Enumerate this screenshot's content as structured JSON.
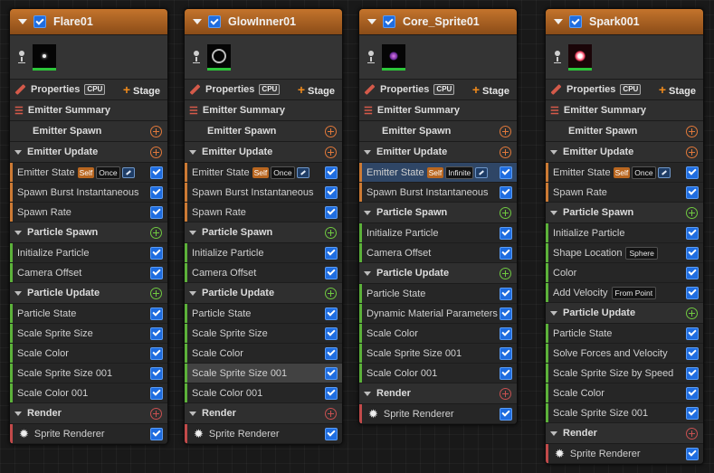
{
  "emitters": [
    {
      "name": "Flare01",
      "thumb": "flare",
      "properties": "Properties",
      "cpu": "CPU",
      "stage": "Stage",
      "sections": [
        {
          "title": "Emitter Summary",
          "icon": "list",
          "chevron": false,
          "add": null,
          "modules": []
        },
        {
          "title": "Emitter Spawn",
          "icon": null,
          "chevron": false,
          "add": "orange",
          "modules": []
        },
        {
          "title": "Emitter Update",
          "icon": null,
          "chevron": true,
          "add": "orange",
          "stripe": "orange",
          "modules": [
            {
              "label": "Emitter State",
              "chips": [
                "Self",
                "Once"
              ],
              "icon": true
            },
            {
              "label": "Spawn Burst Instantaneous"
            },
            {
              "label": "Spawn Rate"
            }
          ]
        },
        {
          "title": "Particle Spawn",
          "icon": null,
          "chevron": true,
          "add": "green",
          "stripe": "green",
          "modules": [
            {
              "label": "Initialize Particle"
            },
            {
              "label": "Camera Offset"
            }
          ]
        },
        {
          "title": "Particle Update",
          "icon": null,
          "chevron": true,
          "add": "green",
          "stripe": "green",
          "modules": [
            {
              "label": "Particle State"
            },
            {
              "label": "Scale Sprite Size"
            },
            {
              "label": "Scale Color"
            },
            {
              "label": "Scale Sprite Size 001"
            },
            {
              "label": "Scale Color 001"
            }
          ]
        },
        {
          "title": "Render",
          "icon": null,
          "chevron": true,
          "add": "red",
          "stripe": "red",
          "modules": [
            {
              "label": "Sprite Renderer",
              "star": true
            }
          ]
        }
      ]
    },
    {
      "name": "GlowInner01",
      "thumb": "glow",
      "properties": "Properties",
      "cpu": "CPU",
      "stage": "Stage",
      "sections": [
        {
          "title": "Emitter Summary",
          "icon": "list",
          "chevron": false,
          "add": null,
          "modules": []
        },
        {
          "title": "Emitter Spawn",
          "icon": null,
          "chevron": false,
          "add": "orange",
          "modules": []
        },
        {
          "title": "Emitter Update",
          "icon": null,
          "chevron": true,
          "add": "orange",
          "stripe": "orange",
          "modules": [
            {
              "label": "Emitter State",
              "chips": [
                "Self",
                "Once"
              ],
              "icon": true
            },
            {
              "label": "Spawn Burst Instantaneous"
            },
            {
              "label": "Spawn Rate"
            }
          ]
        },
        {
          "title": "Particle Spawn",
          "icon": null,
          "chevron": true,
          "add": "green",
          "stripe": "green",
          "modules": [
            {
              "label": "Initialize Particle"
            },
            {
              "label": "Camera Offset"
            }
          ]
        },
        {
          "title": "Particle Update",
          "icon": null,
          "chevron": true,
          "add": "green",
          "stripe": "green",
          "modules": [
            {
              "label": "Particle State"
            },
            {
              "label": "Scale Sprite Size"
            },
            {
              "label": "Scale Color"
            },
            {
              "label": "Scale Sprite Size 001",
              "hl": true
            },
            {
              "label": "Scale Color 001"
            }
          ]
        },
        {
          "title": "Render",
          "icon": null,
          "chevron": true,
          "add": "red",
          "stripe": "red",
          "modules": [
            {
              "label": "Sprite Renderer",
              "star": true
            }
          ]
        }
      ]
    },
    {
      "name": "Core_Sprite01",
      "thumb": "core",
      "properties": "Properties",
      "cpu": "CPU",
      "stage": "Stage",
      "sections": [
        {
          "title": "Emitter Summary",
          "icon": "list",
          "chevron": false,
          "add": null,
          "modules": []
        },
        {
          "title": "Emitter Spawn",
          "icon": null,
          "chevron": false,
          "add": "orange",
          "modules": []
        },
        {
          "title": "Emitter Update",
          "icon": null,
          "chevron": true,
          "add": "orange",
          "stripe": "orange",
          "modules": [
            {
              "label": "Emitter State",
              "chips": [
                "Self",
                "Infinite"
              ],
              "icon": true,
              "sel": true
            },
            {
              "label": "Spawn Burst Instantaneous"
            }
          ]
        },
        {
          "title": "Particle Spawn",
          "icon": null,
          "chevron": true,
          "add": "green",
          "stripe": "green",
          "modules": [
            {
              "label": "Initialize Particle"
            },
            {
              "label": "Camera Offset"
            }
          ]
        },
        {
          "title": "Particle Update",
          "icon": null,
          "chevron": true,
          "add": "green",
          "stripe": "green",
          "modules": [
            {
              "label": "Particle State"
            },
            {
              "label": "Dynamic Material Parameters"
            },
            {
              "label": "Scale Color"
            },
            {
              "label": "Scale Sprite Size 001"
            },
            {
              "label": "Scale Color 001"
            }
          ]
        },
        {
          "title": "Render",
          "icon": null,
          "chevron": true,
          "add": "red",
          "stripe": "red",
          "modules": [
            {
              "label": "Sprite Renderer",
              "star": true
            }
          ]
        }
      ]
    },
    {
      "name": "Spark001",
      "thumb": "spark",
      "properties": "Properties",
      "cpu": "CPU",
      "stage": "Stage",
      "sections": [
        {
          "title": "Emitter Summary",
          "icon": "list",
          "chevron": false,
          "add": null,
          "modules": []
        },
        {
          "title": "Emitter Spawn",
          "icon": null,
          "chevron": false,
          "add": "orange",
          "modules": []
        },
        {
          "title": "Emitter Update",
          "icon": null,
          "chevron": true,
          "add": "orange",
          "stripe": "orange",
          "modules": [
            {
              "label": "Emitter State",
              "chips": [
                "Self",
                "Once"
              ],
              "icon": true
            },
            {
              "label": "Spawn Rate"
            }
          ]
        },
        {
          "title": "Particle Spawn",
          "icon": null,
          "chevron": true,
          "add": "green",
          "stripe": "green",
          "modules": [
            {
              "label": "Initialize Particle"
            },
            {
              "label": "Shape Location",
              "shape": "Sphere"
            },
            {
              "label": "Color"
            },
            {
              "label": "Add Velocity",
              "shape": "From Point"
            }
          ]
        },
        {
          "title": "Particle Update",
          "icon": null,
          "chevron": true,
          "add": "green",
          "stripe": "green",
          "modules": [
            {
              "label": "Particle State"
            },
            {
              "label": "Solve Forces and Velocity"
            },
            {
              "label": "Scale Sprite Size by Speed"
            },
            {
              "label": "Scale Color"
            },
            {
              "label": "Scale Sprite Size 001"
            }
          ]
        },
        {
          "title": "Render",
          "icon": null,
          "chevron": true,
          "add": "red",
          "stripe": "red",
          "modules": [
            {
              "label": "Sprite Renderer",
              "star": true
            }
          ]
        }
      ]
    }
  ]
}
